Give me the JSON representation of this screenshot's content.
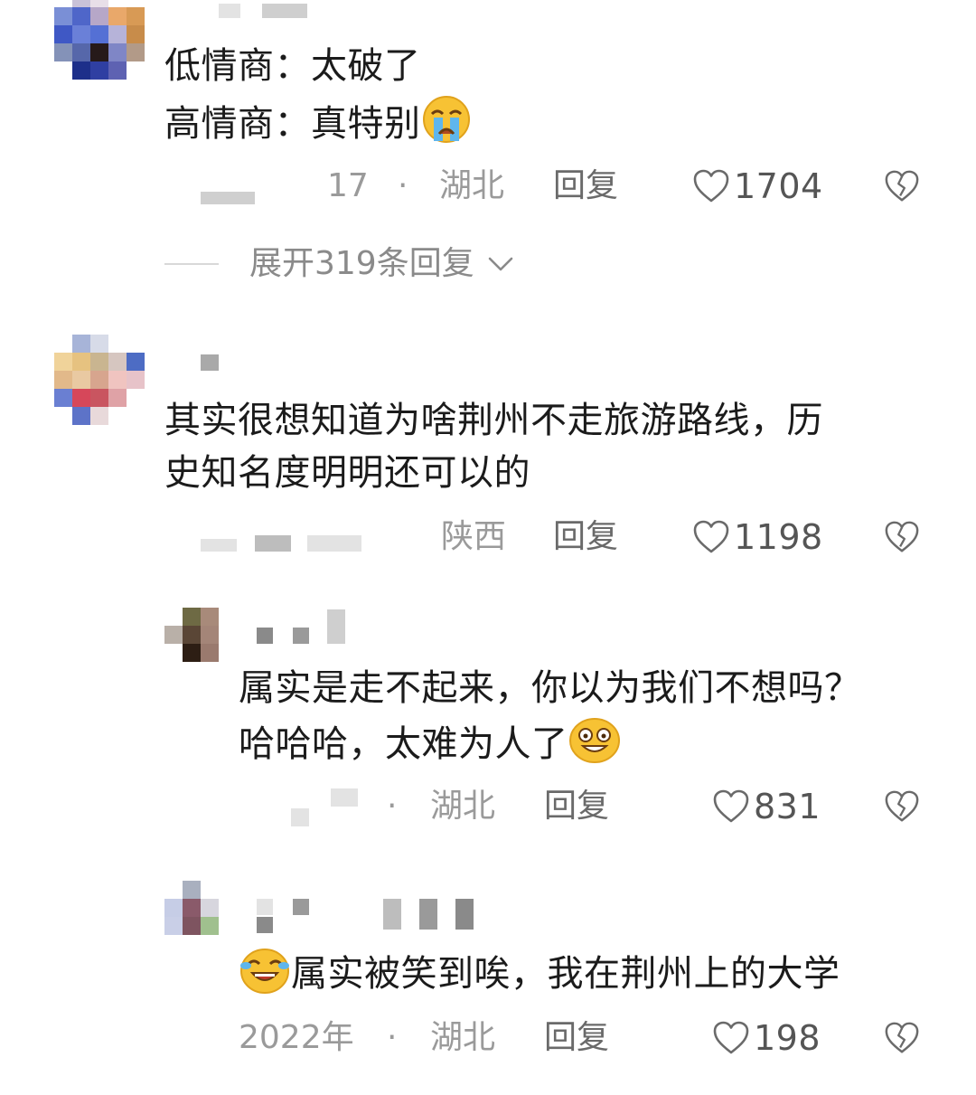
{
  "comments": [
    {
      "lines": [
        "低情商：太破了",
        "高情商：真特别"
      ],
      "emoji": "crying-face",
      "date": "17",
      "dot": "·",
      "location": "湖北",
      "reply_label": "回复",
      "likes": "1704",
      "expand_label": "展开319条回复"
    },
    {
      "lines": [
        "其实很想知道为啥荆州不走旅游路线，历",
        "史知名度明明还可以的"
      ],
      "location": "陕西",
      "reply_label": "回复",
      "likes": "1198"
    }
  ],
  "replies": [
    {
      "lines": [
        "属实是走不起来，你以为我们不想吗？",
        "哈哈哈，太难为人了"
      ],
      "emoji": "grinning-face",
      "dot": "·",
      "location": "湖北",
      "reply_label": "回复",
      "likes": "831"
    },
    {
      "emoji": "laughing-crying-face",
      "line": "属实被笑到唉，我在荆州上的大学",
      "date": "2022年",
      "dot": "·",
      "location": "湖北",
      "reply_label": "回复",
      "likes": "198"
    }
  ],
  "colors": {
    "text": "#1b1b1b",
    "meta": "#9a9a9a",
    "reply": "#6a6a6a",
    "like": "#555555"
  }
}
